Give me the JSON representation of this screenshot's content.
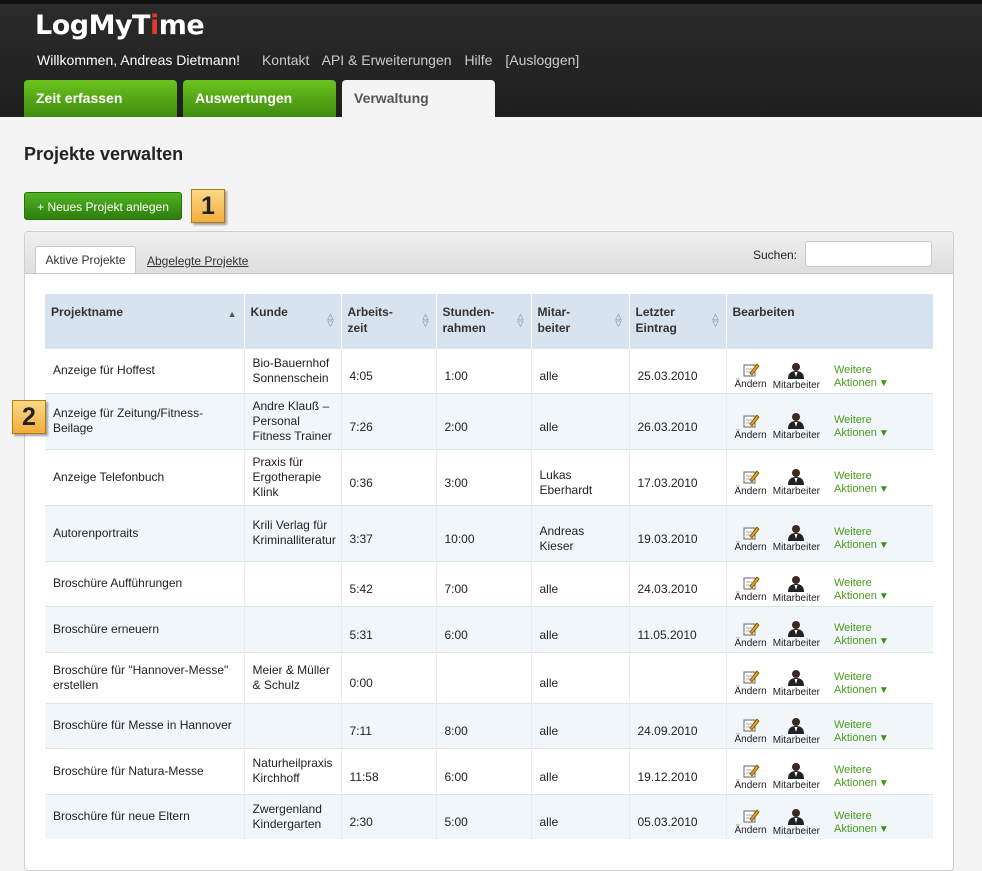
{
  "app": {
    "logo_main": "LogMyT",
    "logo_accent": "i",
    "logo_end": "me"
  },
  "topnav": {
    "welcome": "Willkommen, Andreas Dietmann!",
    "links": [
      "Kontakt",
      "API & Erweiterungen",
      "Hilfe",
      "[Ausloggen]"
    ]
  },
  "tabs": [
    "Zeit erfassen",
    "Auswertungen",
    "Verwaltung"
  ],
  "page": {
    "title": "Projekte verwalten",
    "new_button": "+ Neues Projekt anlegen",
    "markers": [
      "1",
      "2"
    ]
  },
  "subtabs": {
    "active": "Aktive Projekte",
    "archived": "Abgelegte Projekte"
  },
  "search": {
    "label": "Suchen:",
    "value": ""
  },
  "table": {
    "headers": [
      "Projektname",
      "Kunde",
      "Arbeits-\nzeit",
      "Stunden-\nrahmen",
      "Mitar-\nbeiter",
      "Letzter\nEintrag",
      "Bearbeiten"
    ],
    "action_labels": {
      "edit": "Ändern",
      "staff": "Mitarbeiter",
      "more": "Weitere\nAktionen"
    },
    "rows": [
      {
        "name": "Anzeige für Hoffest",
        "customer": "Bio-Bauernhof Sonnenschein",
        "worktime": "4:05",
        "budget": "1:00",
        "staff": "alle",
        "last": "25.03.2010"
      },
      {
        "name": "Anzeige für Zeitung/Fitness-Beilage",
        "customer": "Andre Klauß – Personal Fitness Trainer",
        "worktime": "7:26",
        "budget": "2:00",
        "staff": "alle",
        "last": "26.03.2010"
      },
      {
        "name": "Anzeige Telefonbuch",
        "customer": "Praxis für Ergotherapie Klink",
        "worktime": "0:36",
        "budget": "3:00",
        "staff": "Lukas Eberhardt",
        "last": "17.03.2010"
      },
      {
        "name": "Autorenportraits",
        "customer": "Krili Verlag für Kriminalliteratur",
        "worktime": "3:37",
        "budget": "10:00",
        "staff": "Andreas Kieser",
        "last": "19.03.2010"
      },
      {
        "name": "Broschüre Aufführungen",
        "customer": "",
        "worktime": "5:42",
        "budget": "7:00",
        "staff": "alle",
        "last": "24.03.2010"
      },
      {
        "name": "Broschüre erneuern",
        "customer": "",
        "worktime": "5:31",
        "budget": "6:00",
        "staff": "alle",
        "last": "11.05.2010"
      },
      {
        "name": "Broschüre für \"Hannover-Messe\" erstellen",
        "customer": "Meier & Müller & Schulz",
        "worktime": "0:00",
        "budget": "",
        "staff": "alle",
        "last": ""
      },
      {
        "name": "Broschüre für Messe in Hannover",
        "customer": "",
        "worktime": "7:11",
        "budget": "8:00",
        "staff": "alle",
        "last": "24.09.2010"
      },
      {
        "name": "Broschüre für Natura-Messe",
        "customer": "Naturheilpraxis Kirchhoff",
        "worktime": "11:58",
        "budget": "6:00",
        "staff": "alle",
        "last": "19.12.2010"
      },
      {
        "name": "Broschüre für neue Eltern",
        "customer": "Zwergenland Kindergarten",
        "worktime": "2:30",
        "budget": "5:00",
        "staff": "alle",
        "last": "05.03.2010"
      }
    ]
  }
}
